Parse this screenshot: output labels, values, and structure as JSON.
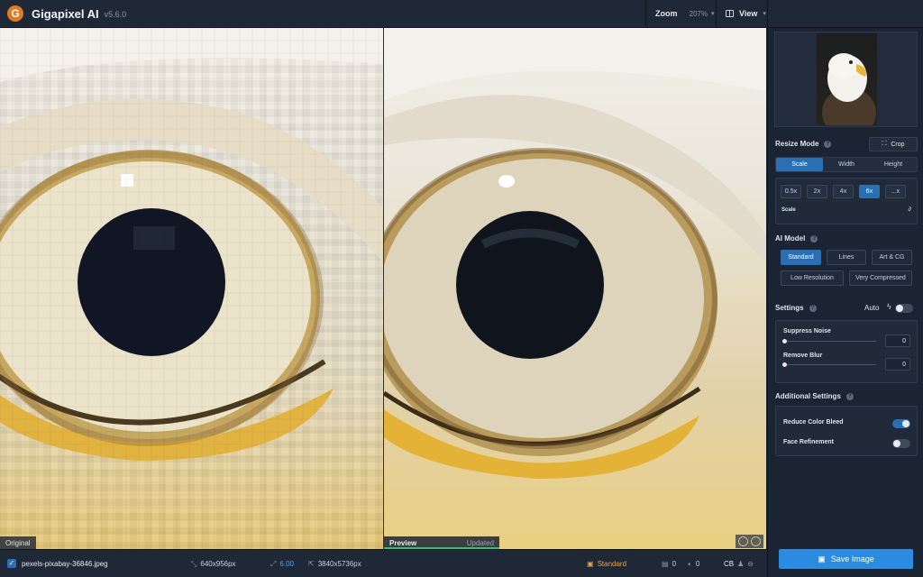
{
  "app": {
    "title": "Gigapixel AI",
    "version": "v5.6.0",
    "logo_letter": "G"
  },
  "topbar": {
    "zoom_label": "Zoom",
    "zoom_value": "207%",
    "view_label": "View"
  },
  "panes": {
    "original_label": "Original",
    "preview_label": "Preview",
    "preview_status": "Updated"
  },
  "resize": {
    "title": "Resize Mode",
    "crop_label": "Crop",
    "tabs": [
      "Scale",
      "Width",
      "Height"
    ],
    "active_tab": "Scale",
    "scale_options": [
      "0.5x",
      "2x",
      "4x",
      "6x",
      "...x"
    ],
    "active_scale": "6x",
    "scale_label": "Scale"
  },
  "ai_model": {
    "title": "AI Model",
    "options": [
      "Standard",
      "Lines",
      "Art & CG",
      "Low Resolution",
      "Very Compressed"
    ],
    "active": "Standard"
  },
  "settings": {
    "title": "Settings",
    "auto_label": "Auto",
    "auto_on": false,
    "suppress_noise_label": "Suppress Noise",
    "suppress_noise_value": "0",
    "remove_blur_label": "Remove Blur",
    "remove_blur_value": "0"
  },
  "additional": {
    "title": "Additional Settings",
    "reduce_color_bleed_label": "Reduce Color Bleed",
    "reduce_color_bleed_on": true,
    "face_refinement_label": "Face Refinement",
    "face_refinement_on": false
  },
  "bottombar": {
    "filename": "pexels-pixabay-36846.jpeg",
    "input_size": "640x956px",
    "scale_factor": "6.00",
    "output_size": "3840x5736px",
    "model": "Standard",
    "count_a": "0",
    "count_b": "0",
    "cb_label": "CB"
  },
  "save": {
    "label": "Save Image"
  },
  "colors": {
    "accent": "#2a6fb3",
    "save": "#2a8be0",
    "model_tag": "#e8a33a",
    "preview_ok": "#32c16e"
  }
}
